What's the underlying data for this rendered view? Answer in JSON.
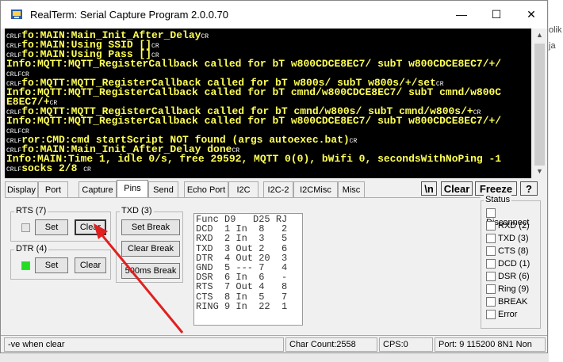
{
  "background_right": [
    "olik",
    "ja"
  ],
  "window": {
    "title": "RealTerm: Serial Capture Program 2.0.0.70",
    "minimize": "—",
    "maximize": "☐",
    "close": "✕"
  },
  "terminal_lines": [
    {
      "prefix": "CRLF",
      "text": "fo:MAIN:Main_Init_After_Delay",
      "suffix": "CR"
    },
    {
      "prefix": "CRLF",
      "text": "fo:MAIN:Using SSID []",
      "suffix": "CR"
    },
    {
      "prefix": "CRLF",
      "text": "fo:MAIN:Using Pass []",
      "suffix": "CR"
    },
    {
      "prefix": "",
      "text": "Info:MQTT:MQTT_RegisterCallback called for bT w800CDCE8EC7/ subT w800CDCE8EC7/+/",
      "suffix": ""
    },
    {
      "prefix": "CRLF",
      "text": "",
      "suffix": "CR"
    },
    {
      "prefix": "CRLF",
      "text": "fo:MQTT:MQTT_RegisterCallback called for bT w800s/ subT w800s/+/set",
      "suffix": "CR"
    },
    {
      "prefix": "",
      "text": "Info:MQTT:MQTT_RegisterCallback called for bT cmnd/w800CDCE8EC7/ subT cmnd/w800C",
      "suffix": ""
    },
    {
      "prefix": "",
      "text": "E8EC7/+",
      "suffix": "CR"
    },
    {
      "prefix": "CRLF",
      "text": "fo:MQTT:MQTT_RegisterCallback called for bT cmnd/w800s/ subT cmnd/w800s/+",
      "suffix": "CR"
    },
    {
      "prefix": "",
      "text": "Info:MQTT:MQTT_RegisterCallback called for bT w800CDCE8EC7/ subT w800CDCE8EC7/+/",
      "suffix": ""
    },
    {
      "prefix": "CRLF",
      "text": "",
      "suffix": "CR"
    },
    {
      "prefix": "CRLF",
      "text": "ror:CMD:cmd startScript NOT found (args autoexec.bat)",
      "suffix": "CR"
    },
    {
      "prefix": "CRLF",
      "text": "fo:MAIN:Main_Init_After_Delay done",
      "suffix": "CR"
    },
    {
      "prefix": "",
      "text": "Info:MAIN:Time 1, idle 0/s, free 29592, MQTT 0(0), bWifi 0, secondsWithNoPing -1",
      "suffix": ""
    },
    {
      "prefix": "CRLF",
      "text": "socks 2/8 ",
      "suffix": "CR"
    }
  ],
  "tabs": [
    "Display",
    "Port",
    "Capture",
    "Pins",
    "Send",
    "Echo Port",
    "I2C",
    "I2C-2",
    "I2CMisc",
    "Misc"
  ],
  "active_tab": "Pins",
  "toolbar": {
    "newline": "\\n",
    "clear": "Clear",
    "freeze": "Freeze",
    "help": "?"
  },
  "rts": {
    "label": "RTS (7)",
    "set": "Set",
    "clear": "Clear",
    "lamp_color": "#e6e6e6"
  },
  "dtr": {
    "label": "DTR (4)",
    "set": "Set",
    "clear": "Clear",
    "lamp_color": "#22dd22"
  },
  "txd": {
    "label": "TXD (3)",
    "set_break": "Set Break",
    "clear_break": "Clear Break",
    "break_500": "500ms Break"
  },
  "pins_table": [
    "Func D9   D25 RJ",
    "DCD  1 In  8   2",
    "RXD  2 In  3   5",
    "TXD  3 Out 2   6",
    "DTR  4 Out 20  3",
    "GND  5 --- 7   4",
    "DSR  6 In  6   -",
    "RTS  7 Out 4   8",
    "CTS  8 In  5   7",
    "RING 9 In  22  1"
  ],
  "status": {
    "label": "Status",
    "items": [
      "Disconnect",
      "RXD (2)",
      "TXD (3)",
      "CTS (8)",
      "DCD (1)",
      "DSR (6)",
      "Ring (9)",
      "BREAK",
      "Error"
    ]
  },
  "statusbar": {
    "hint": "-ve when clear",
    "char_count": "Char Count:2558",
    "cps": "CPS:0",
    "port": "Port: 9 115200 8N1 Non"
  },
  "colors": {
    "terminal_text": "#ffff55",
    "annotation_arrow": "#e02020"
  }
}
